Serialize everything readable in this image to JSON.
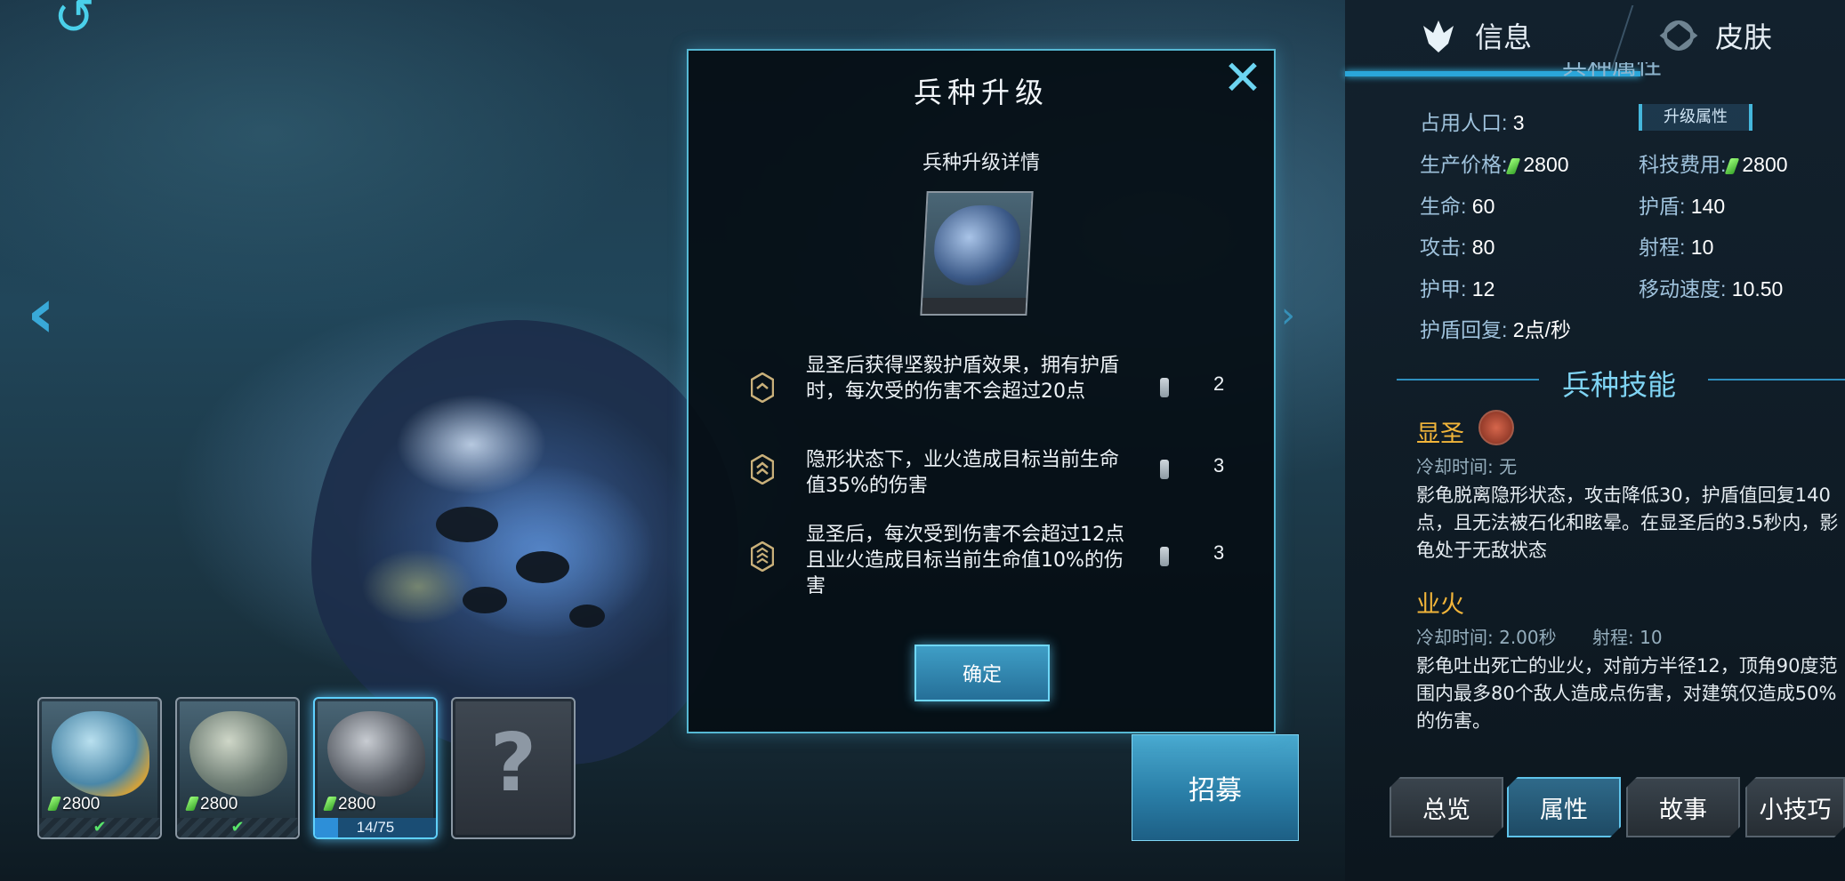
{
  "modal": {
    "title": "兵种升级",
    "subtitle": "兵种升级详情",
    "upgrades": [
      {
        "desc": "显圣后获得坚毅护盾效果，拥有护盾时，每次受的伤害不会超过20点",
        "cost": "2"
      },
      {
        "desc": "隐形状态下，业火造成目标当前生命值35%的伤害",
        "cost": "3"
      },
      {
        "desc": "显圣后，每次受到伤害不会超过12点且业火造成目标当前生命值10%的伤害",
        "cost": "3"
      }
    ],
    "confirm_label": "确定"
  },
  "units": [
    {
      "cost": "2800",
      "status": "✔"
    },
    {
      "cost": "2800",
      "status": "✔"
    },
    {
      "cost": "2800",
      "progress_text": "14/75",
      "progress": 0.19
    },
    {
      "locked_label": "?"
    }
  ],
  "recruit_label": "招募",
  "panel": {
    "tabs": [
      "信息",
      "皮肤"
    ],
    "partial_header": "兵种属性",
    "upgrade_attr_label": "升级属性",
    "stats": {
      "population_label": "占用人口:",
      "population": "3",
      "price_label": "生产价格:",
      "price": "2800",
      "tech_label": "科技费用:",
      "tech": "2800",
      "hp_label": "生命:",
      "hp": "60",
      "shield_label": "护盾:",
      "shield": "140",
      "atk_label": "攻击:",
      "atk": "80",
      "range_label": "射程:",
      "range": "10",
      "armor_label": "护甲:",
      "armor": "12",
      "speed_label": "移动速度:",
      "speed": "10.50",
      "regen_label": "护盾回复:",
      "regen": "2点/秒"
    },
    "skills_title": "兵种技能",
    "skills": [
      {
        "name": "显圣",
        "meta": "冷却时间: 无",
        "desc": "影龟脱离隐形状态，攻击降低30，护盾值回复140点，且无法被石化和眩晕。在显圣后的3.5秒内，影龟处于无敌状态"
      },
      {
        "name": "业火",
        "meta": "冷却时间: 2.00秒",
        "meta2": "射程: 10",
        "desc": "影龟吐出死亡的业火，对前方半径12，顶角90度范围内最多80个敌人造成点伤害，对建筑仅造成50%的伤害。"
      }
    ],
    "bottom_tabs": [
      "总览",
      "属性",
      "故事",
      "小技巧"
    ]
  }
}
